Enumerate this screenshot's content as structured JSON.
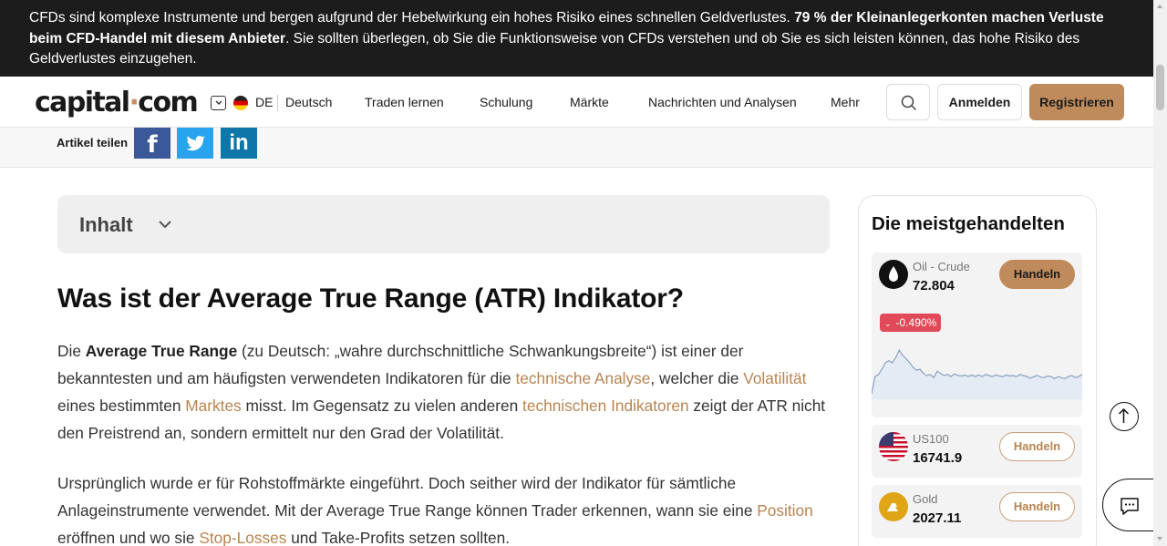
{
  "risk_banner": {
    "text_part1": "CFDs sind komplexe Instrumente und bergen aufgrund der Hebelwirkung ein hohes Risiko eines schnellen Geldverlustes. ",
    "text_bold": "79 % der Kleinanlegerkonten machen Verluste beim CFD-Handel mit diesem Anbieter",
    "text_part2": ". Sie sollten überlegen, ob Sie die Funktionsweise von CFDs verstehen und ob Sie es sich leisten können, das hohe Risiko des Geldverlustes einzugehen."
  },
  "header": {
    "logo_left": "capital",
    "logo_dot": "·",
    "logo_right": "com",
    "lang_code": "DE",
    "lang_name": "Deutsch",
    "nav": [
      "Traden lernen",
      "Schulung",
      "Märkte",
      "Nachrichten und Analysen",
      "Mehr"
    ],
    "login": "Anmelden",
    "register": "Registrieren"
  },
  "share": {
    "label": "Artikel teilen",
    "fb": "f",
    "tw": "t",
    "li": "in"
  },
  "toc": {
    "title": "Inhalt"
  },
  "article": {
    "title": "Was ist der Average True Range (ATR) Indikator?",
    "p1": {
      "t1": "Die ",
      "b1": "Average True Range",
      "t2": " (zu Deutsch: „wahre durchschnittliche Schwankungsbreite“) ist einer der bekanntesten und am häufigsten verwendeten Indikatoren für die ",
      "l1": "technische Analyse",
      "t3": ", welcher die ",
      "l2": "Volatilität",
      "t4": " eines bestimmten ",
      "l3": "Marktes",
      "t5": " misst. Im Gegensatz zu vielen anderen ",
      "l4": "technischen Indikatoren",
      "t6": " zeigt der ATR nicht den Preistrend an, sondern ermittelt nur den Grad der Volatilität."
    },
    "p2": {
      "t1": "Ursprünglich wurde er für Rohstoffmärkte eingeführt. Doch seither wird der Indikator für sämtliche Anlageinstrumente verwendet. Mit der Average True Range können Trader erkennen, wann sie eine ",
      "l1": "Position",
      "t2": " eröffnen und wo sie ",
      "l2": "Stop-Losses",
      "t3": " und Take-Profits setzen sollten."
    }
  },
  "sidebar": {
    "title": "Die meistgehandelten",
    "assets": [
      {
        "name": "Oil - Crude",
        "price": "72.804",
        "button": "Handeln",
        "change": "-0.490%"
      },
      {
        "name": "US100",
        "price": "16741.9",
        "button": "Handeln"
      },
      {
        "name": "Gold",
        "price": "2027.11",
        "button": "Handeln"
      }
    ],
    "sparkline": [
      0.04,
      0.36,
      0.4,
      0.5,
      0.62,
      0.66,
      0.62,
      0.72,
      0.86,
      0.76,
      0.7,
      0.62,
      0.54,
      0.48,
      0.5,
      0.42,
      0.38,
      0.4,
      0.34,
      0.46,
      0.42,
      0.38,
      0.4,
      0.36,
      0.41,
      0.38,
      0.37,
      0.39,
      0.36,
      0.39,
      0.36,
      0.39,
      0.36,
      0.4,
      0.38,
      0.36,
      0.39,
      0.37,
      0.36,
      0.39,
      0.37,
      0.38,
      0.36,
      0.4,
      0.38,
      0.36,
      0.33,
      0.36,
      0.38,
      0.35,
      0.34,
      0.37,
      0.36,
      0.32,
      0.36,
      0.34,
      0.32,
      0.36,
      0.38,
      0.34,
      0.36,
      0.4
    ],
    "colors": {
      "negative": "#e04a59",
      "accent": "#c08b5c"
    }
  },
  "widgets": {
    "scroll_top_icon": "arrow-up-icon",
    "chat_icon": "chat-icon"
  }
}
